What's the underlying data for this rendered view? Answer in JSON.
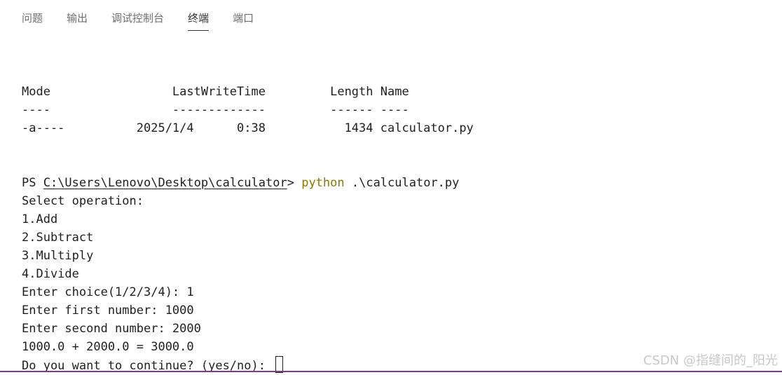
{
  "tabs": [
    {
      "label": "问题"
    },
    {
      "label": "输出"
    },
    {
      "label": "调试控制台"
    },
    {
      "label": "终端",
      "active": true
    },
    {
      "label": "端口"
    }
  ],
  "terminal": {
    "listing": {
      "header": "Mode                 LastWriteTime         Length Name",
      "separator": "----                 -------------         ------ ----",
      "rows": [
        "-a----          2025/1/4      0:38           1434 calculator.py"
      ]
    },
    "prompt": {
      "ps": "PS ",
      "path": "C:\\Users\\Lenovo\\Desktop\\calculator",
      "gt": "> ",
      "command": "python",
      "args": " .\\calculator.py"
    },
    "output": [
      "Select operation:",
      "1.Add",
      "2.Subtract",
      "3.Multiply",
      "4.Divide",
      "Enter choice(1/2/3/4): 1",
      "Enter first number: 1000",
      "Enter second number: 2000",
      "1000.0 + 2000.0 = 3000.0"
    ],
    "last_prompt": "Do you want to continue? (yes/no): "
  },
  "colors": {
    "command": "#8a7a00",
    "border": "#7d3c8b",
    "text": "#1f1f1f"
  },
  "watermark": "CSDN @指缝间的_阳光"
}
